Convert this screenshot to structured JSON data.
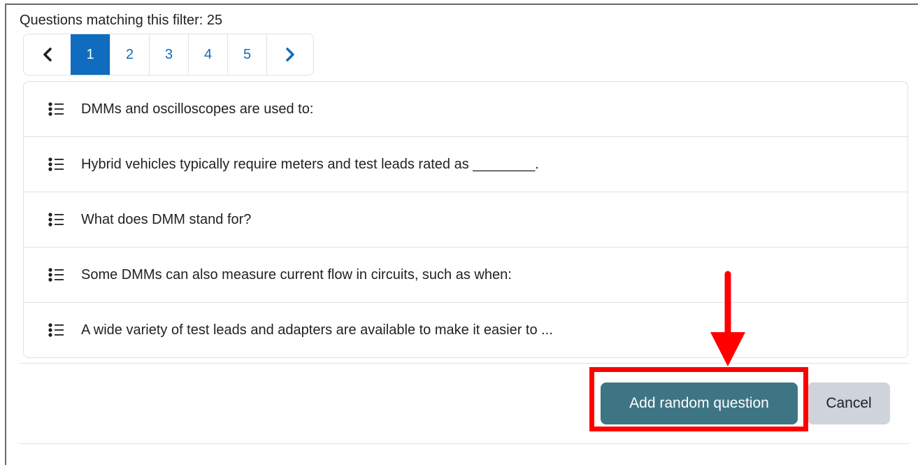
{
  "filter": {
    "count_text": "Questions matching this filter: 25"
  },
  "pagination": {
    "prev_icon": "chevron-left-icon",
    "pages": [
      "1",
      "2",
      "3",
      "4",
      "5"
    ],
    "active_page": "1",
    "next_icon": "chevron-right-icon"
  },
  "questions": [
    {
      "icon": "multichoice-icon",
      "text": "DMMs and oscilloscopes are used to:"
    },
    {
      "icon": "multichoice-icon",
      "text": "Hybrid vehicles typically require meters and test leads rated as ________."
    },
    {
      "icon": "multichoice-icon",
      "text": "What does DMM stand for?"
    },
    {
      "icon": "multichoice-icon",
      "text": "Some DMMs can also measure current flow in circuits, such as when:"
    },
    {
      "icon": "multichoice-icon",
      "text": "A wide variety of test leads and adapters are available to make it easier to ..."
    }
  ],
  "actions": {
    "add_label": "Add random question",
    "cancel_label": "Cancel"
  },
  "annotation": {
    "highlight_color": "#ff0000",
    "arrow_color": "#ff0000"
  },
  "colors": {
    "primary": "#0f6cbf",
    "add_button": "#3d7585",
    "cancel_button": "#ced4da"
  }
}
